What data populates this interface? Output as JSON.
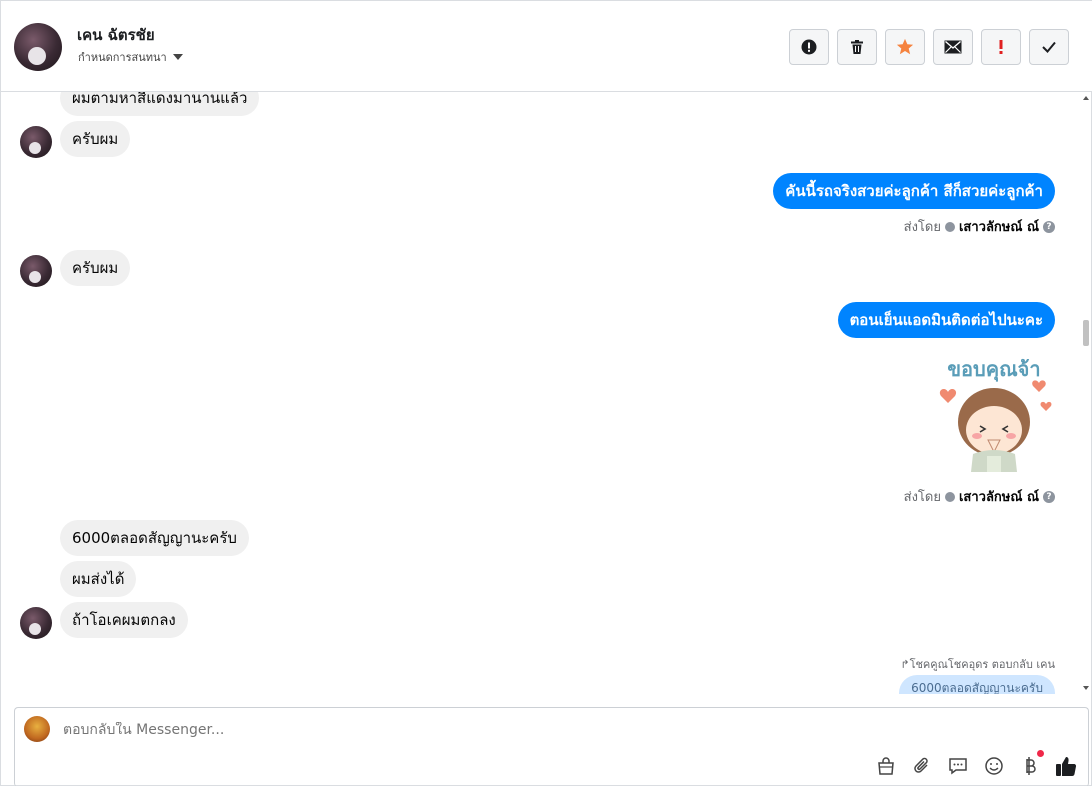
{
  "header": {
    "contact_name": "เคน ฉัตรชัย",
    "contact_sub": "กำหนดการสนทนา",
    "actions": [
      "spam-icon",
      "trash-icon",
      "star-icon",
      "mail-icon",
      "important-icon",
      "check-icon"
    ]
  },
  "messages": {
    "m0": "ผมตามหาสีแดงมานานแล้ว",
    "m1": "ครับผม",
    "m2": "คันนี้รถจริงสวยค่ะลูกค้า สีก็สวยค่ะลูกค้า",
    "m2_sentby_label": "ส่งโดย",
    "m2_sentby_name": "เสาวลักษณ์ ณ์",
    "m3": "ครับผม",
    "m4": "ตอนเย็นแอดมินติดต่อไปนะคะ",
    "sticker_text": "ขอบคุณจ้า",
    "m4_sentby_label": "ส่งโดย",
    "m4_sentby_name": "เสาวลักษณ์ ณ์",
    "m5": "6000ตลอดสัญญานะครับ",
    "m6": "ผมส่งได้",
    "m7": "ถ้าโอเคผมตกลง",
    "reply_note": "โชคคูณโชคอุดร ตอบกลับ เคน",
    "quote": "6000ตลอดสัญญานะครับ"
  },
  "composer": {
    "placeholder": "ตอบกลับใน Messenger...",
    "tools": [
      "bag-icon",
      "paperclip-icon",
      "saved-reply-icon",
      "emoji-icon",
      "baht-icon",
      "like-icon"
    ]
  },
  "colors": {
    "outgoing": "#0084ff",
    "incoming": "#f0f0f0",
    "star": "#f5833f",
    "important": "#e02020"
  }
}
